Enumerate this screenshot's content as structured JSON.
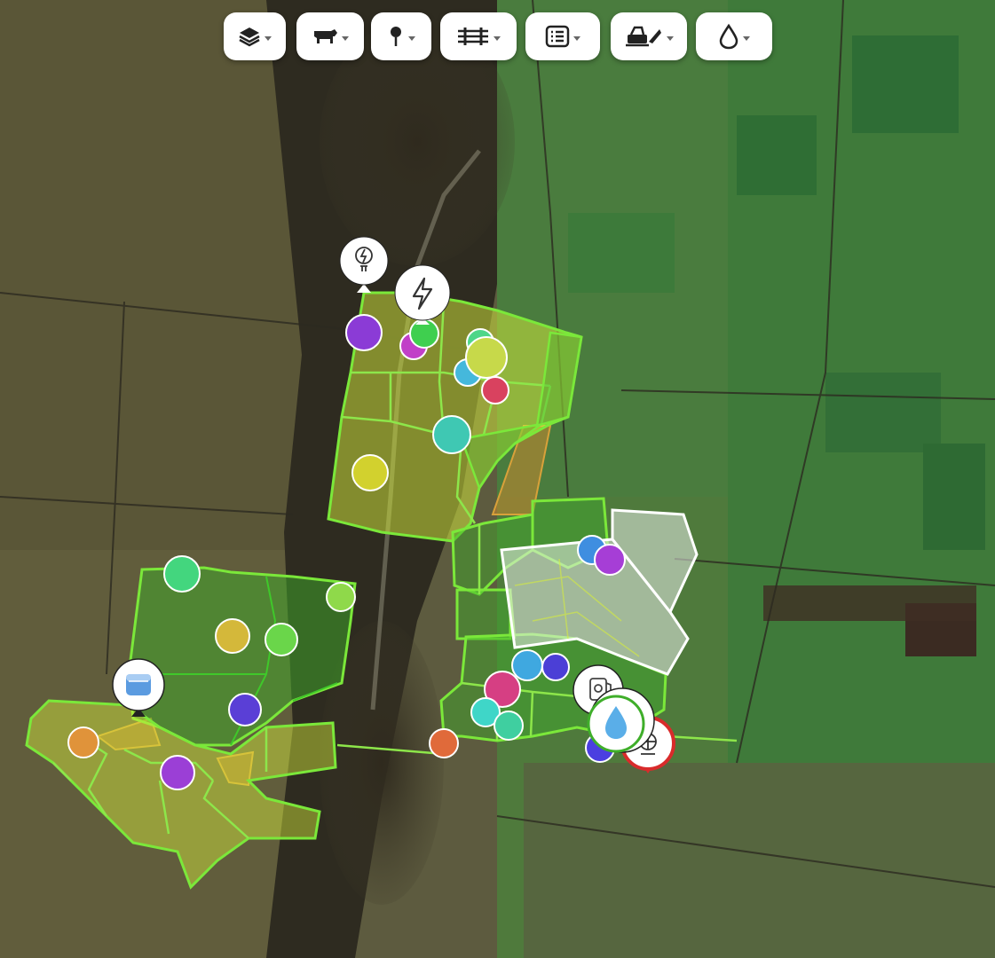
{
  "toolbar": {
    "buttons": [
      {
        "id": "layers",
        "icon": "layers-icon"
      },
      {
        "id": "livestock",
        "icon": "livestock-icon"
      },
      {
        "id": "markers",
        "icon": "map-pin-icon"
      },
      {
        "id": "fences",
        "icon": "fence-icon"
      },
      {
        "id": "list",
        "icon": "list-icon"
      },
      {
        "id": "machinery",
        "icon": "tractor-icon"
      },
      {
        "id": "water",
        "icon": "water-drop-icon"
      }
    ]
  },
  "map": {
    "imagery": "satellite",
    "colors": {
      "paddock_yellow": "#d7ee3c",
      "paddock_green": "#3fae2a",
      "boundary": "#7be83a",
      "orange_area": "#c9862e",
      "white_area": "#e8ece8",
      "pin_red": "#d92b2b"
    },
    "map_pins": [
      {
        "name": "power-point-pin",
        "icon": "power-point-icon"
      },
      {
        "name": "electricity-pin",
        "icon": "lightning-icon"
      },
      {
        "name": "water-tank-pin",
        "icon": "water-tank-icon"
      },
      {
        "name": "fuel-tank-pin",
        "icon": "fuel-tank-icon"
      },
      {
        "name": "water-drop-pin",
        "icon": "water-drop-icon"
      },
      {
        "name": "alert-pin",
        "icon": "pump-icon"
      }
    ],
    "markers": [
      {
        "color": "#8b3bd6"
      },
      {
        "color": "#c13fc8"
      },
      {
        "color": "#3fcf4f"
      },
      {
        "color": "#4ed688"
      },
      {
        "color": "#45b8dc"
      },
      {
        "color": "#c7d94a"
      },
      {
        "color": "#d9425f"
      },
      {
        "color": "#3fc8b3"
      },
      {
        "color": "#d2d12e"
      },
      {
        "color": "#3f8ee0"
      },
      {
        "color": "#a63ed6"
      },
      {
        "color": "#43d67e"
      },
      {
        "color": "#8fd94a"
      },
      {
        "color": "#d4b83a"
      },
      {
        "color": "#6ad64a"
      },
      {
        "color": "#5a3fd6"
      },
      {
        "color": "#e0933a"
      },
      {
        "color": "#9b3fd6"
      },
      {
        "color": "#3fa8e0"
      },
      {
        "color": "#4b3fd6"
      },
      {
        "color": "#d63f83"
      },
      {
        "color": "#3fd6c8"
      },
      {
        "color": "#3fcfa0"
      },
      {
        "color": "#e06a3a"
      },
      {
        "color": "#4b3fe0"
      }
    ]
  }
}
